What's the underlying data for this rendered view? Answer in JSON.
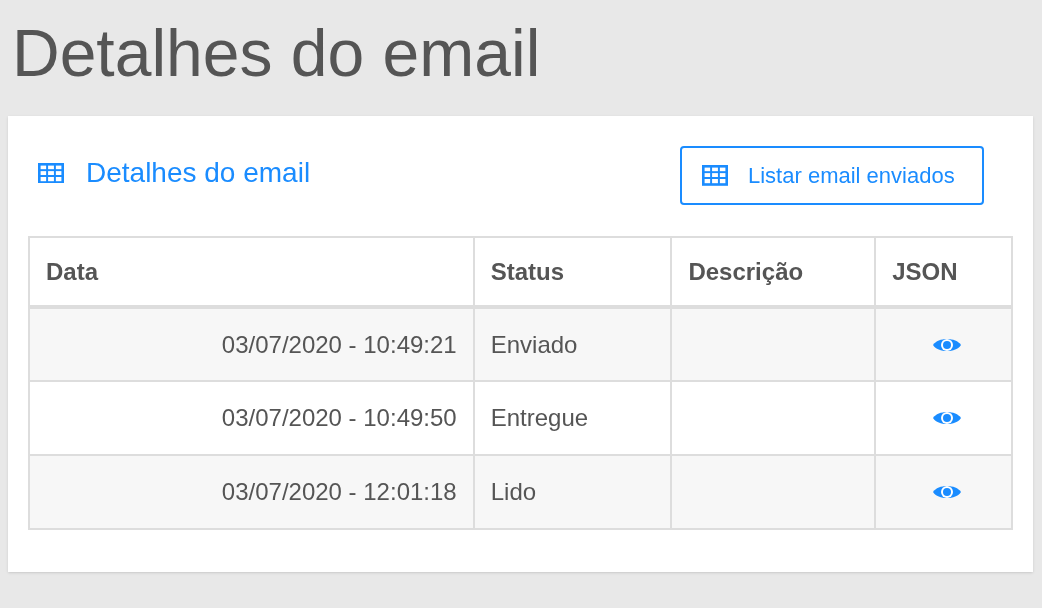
{
  "page_title": "Detalhes do email",
  "card": {
    "title": "Detalhes do email",
    "button": "Listar email enviados"
  },
  "table": {
    "columns": [
      "Data",
      "Status",
      "Descrição",
      "JSON"
    ],
    "rows": [
      {
        "date": "03/07/2020 - 10:49:21",
        "status": "Enviado"
      },
      {
        "date": "03/07/2020 - 10:49:50",
        "status": "Entregue"
      },
      {
        "date": "03/07/2020 - 12:01:18",
        "status": "Lido"
      }
    ]
  }
}
